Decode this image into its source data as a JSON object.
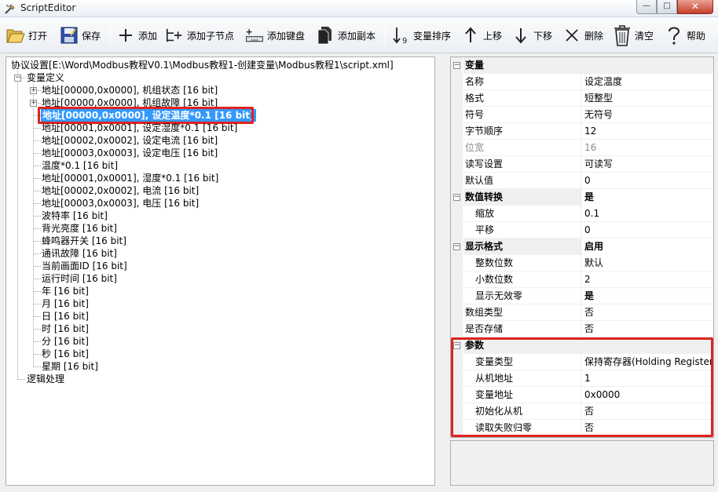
{
  "window": {
    "title": "ScriptEditor",
    "min_glyph": "—",
    "max_glyph": "□",
    "close_glyph": "✕"
  },
  "toolbar": {
    "open": "打开",
    "save": "保存",
    "add": "添加",
    "add_child": "添加子节点",
    "add_keyboard": "添加键盘",
    "add_copy": "添加副本",
    "sort_vars": "变量排序",
    "move_up": "上移",
    "move_down": "下移",
    "delete": "删除",
    "clear": "清空",
    "help": "帮助"
  },
  "tree": {
    "root": "协议设置[E:\\Word\\Modbus教程V0.1\\Modbus教程1-创建变量\\Modbus教程1\\script.xml]",
    "var_def": "变量定义",
    "items": [
      "地址[00000,0x0000], 机组状态 [16 bit]",
      "地址[00000,0x0000], 机组故障 [16 bit]",
      "地址[00000,0x0000], 设定温度*0.1 [16 bit]",
      "地址[00001,0x0001], 设定湿度*0.1 [16 bit]",
      "地址[00002,0x0002], 设定电流 [16 bit]",
      "地址[00003,0x0003], 设定电压 [16 bit]",
      "温度*0.1 [16 bit]",
      "地址[00001,0x0001], 湿度*0.1 [16 bit]",
      "地址[00002,0x0002], 电流 [16 bit]",
      "地址[00003,0x0003], 电压 [16 bit]",
      "波特率 [16 bit]",
      "背光亮度 [16 bit]",
      "蜂鸣器开关 [16 bit]",
      "通讯故障 [16 bit]",
      "当前画面ID [16 bit]",
      "运行时间 [16 bit]",
      "年 [16 bit]",
      "月 [16 bit]",
      "日 [16 bit]",
      "时 [16 bit]",
      "分 [16 bit]",
      "秒 [16 bit]",
      "星期 [16 bit]"
    ],
    "logic": "逻辑处理",
    "expander_plus": "+",
    "expander_minus": "−"
  },
  "props": {
    "cat_var": "变量",
    "name_l": "名称",
    "name_v": "设定温度",
    "format_l": "格式",
    "format_v": "短整型",
    "sign_l": "符号",
    "sign_v": "无符号",
    "byteorder_l": "字节顺序",
    "byteorder_v": "12",
    "width_l": "位宽",
    "width_v": "16",
    "rw_l": "读写设置",
    "rw_v": "可读写",
    "default_l": "默认值",
    "default_v": "0",
    "conv_l": "数值转换",
    "conv_v": "是",
    "scale_l": "缩放",
    "scale_v": "0.1",
    "shift_l": "平移",
    "shift_v": "0",
    "display_l": "显示格式",
    "display_v": "启用",
    "intdigits_l": "整数位数",
    "intdigits_v": "默认",
    "decdigits_l": "小数位数",
    "decdigits_v": "2",
    "zeros_l": "显示无效零",
    "zeros_v": "是",
    "array_l": "数组类型",
    "array_v": "否",
    "store_l": "是否存储",
    "store_v": "否",
    "cat_param": "参数",
    "vartype_l": "变量类型",
    "vartype_v": "保持寄存器(Holding Register)",
    "slave_l": "从机地址",
    "slave_v": "1",
    "addr_l": "变量地址",
    "addr_v": "0x0000",
    "init_l": "初始化从机",
    "init_v": "否",
    "fail_l": "读取失败归零",
    "fail_v": "否"
  }
}
